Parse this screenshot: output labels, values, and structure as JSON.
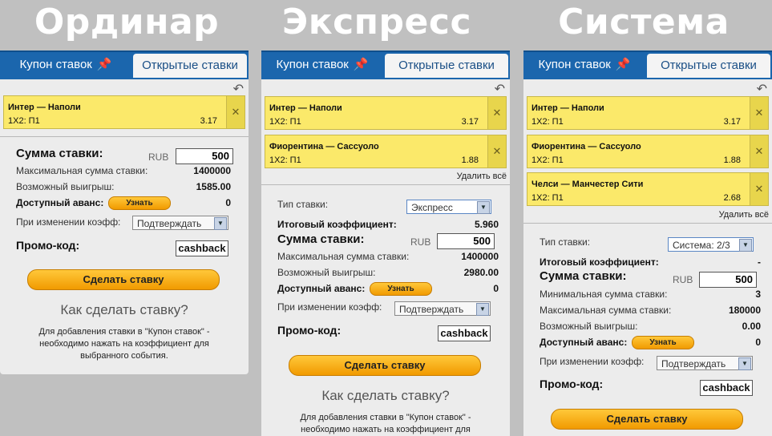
{
  "titles": [
    "Ординар",
    "Экспресс",
    "Система"
  ],
  "tabs": {
    "coupon": "Купон ставок",
    "open": "Открытые ставки"
  },
  "bets": [
    {
      "teams": "Интер — Наполи",
      "market": "1X2: П1",
      "odd": "3.17"
    },
    {
      "teams": "Фиорентина — Сассуоло",
      "market": "1X2: П1",
      "odd": "1.88"
    },
    {
      "teams": "Челси — Манчестер Сити",
      "market": "1X2: П1",
      "odd": "2.68"
    }
  ],
  "labels": {
    "delete_all": "Удалить всё",
    "bet_type": "Тип ставки:",
    "total_coef": "Итоговый коэффициент:",
    "stake": "Сумма ставки:",
    "currency": "RUB",
    "min_stake": "Минимальная сумма ставки:",
    "max_stake": "Максимальная сумма ставки:",
    "possible_win": "Возможный выигрыш:",
    "advance": "Доступный аванс:",
    "learn": "Узнать",
    "on_change": "При изменении коэфф:",
    "confirm": "Подтверждать",
    "promo": "Промо-код:",
    "promo_value": "cashback",
    "place_bet": "Сделать ставку",
    "howto": "Как сделать ставку?",
    "help": "Для добавления ставки в \"Купон ставок\" - необходимо нажать на коэффициент для выбранного события."
  },
  "single": {
    "stake": "500",
    "max": "1400000",
    "win": "1585.00",
    "advance": "0"
  },
  "express": {
    "type": "Экспресс",
    "coef": "5.960",
    "stake": "500",
    "max": "1400000",
    "win": "2980.00",
    "advance": "0"
  },
  "system": {
    "type": "Система: 2/3",
    "coef": "-",
    "stake": "500",
    "min": "3",
    "max": "180000",
    "win": "0.00",
    "advance": "0"
  }
}
